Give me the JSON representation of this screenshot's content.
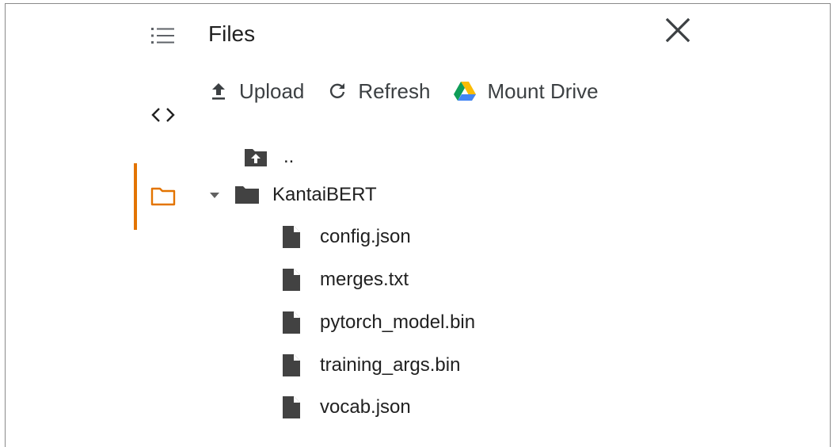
{
  "panel": {
    "title": "Files",
    "close_icon": "close-icon"
  },
  "rail": {
    "items": [
      {
        "icon": "table-of-contents-icon"
      },
      {
        "icon": "code-snippets-icon"
      },
      {
        "icon": "folder-icon",
        "active": true
      }
    ],
    "accent_color": "#e37400"
  },
  "toolbar": {
    "upload_label": "Upload",
    "refresh_label": "Refresh",
    "mount_label": "Mount Drive"
  },
  "tree": {
    "parent_label": "..",
    "folder": {
      "name": "KantaiBERT",
      "expanded": true,
      "files": [
        "config.json",
        "merges.txt",
        "pytorch_model.bin",
        "training_args.bin",
        "vocab.json"
      ]
    }
  }
}
